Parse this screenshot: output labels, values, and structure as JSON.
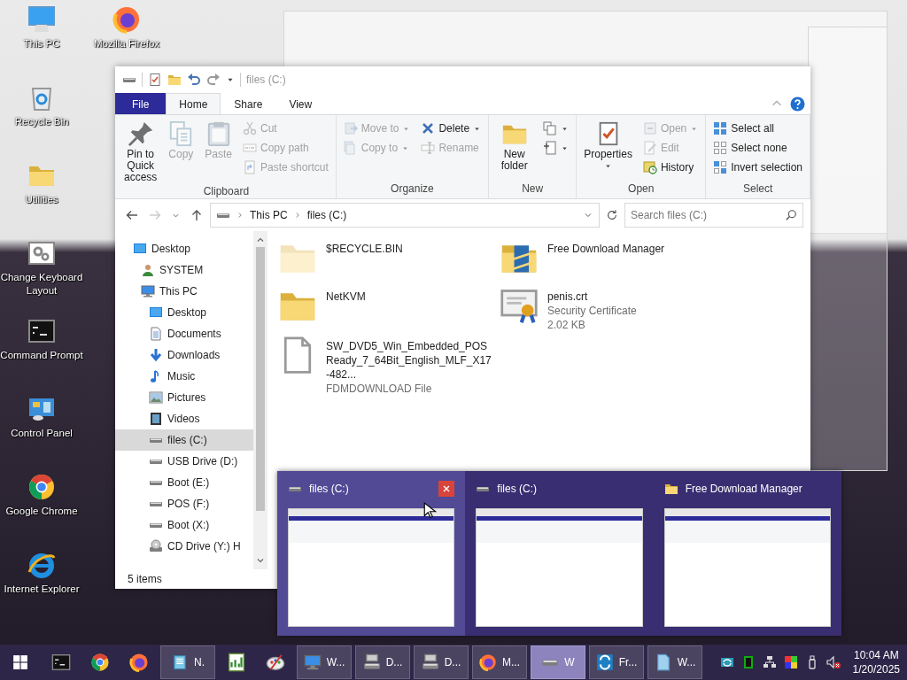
{
  "desktop": {
    "icon_columns": [
      [
        {
          "label": "This PC",
          "kind": "computer"
        },
        {
          "label": "Recycle Bin",
          "kind": "recycle-bin"
        },
        {
          "label": "Utilities",
          "kind": "folder"
        },
        {
          "label": "Change Keyboard Layout",
          "kind": "gear-window"
        },
        {
          "label": "Command Prompt",
          "kind": "cmd"
        },
        {
          "label": "Control Panel",
          "kind": "control-panel"
        },
        {
          "label": "Google Chrome",
          "kind": "chrome"
        },
        {
          "label": "Internet Explorer",
          "kind": "ie"
        }
      ],
      [
        {
          "label": "Mozilla Firefox",
          "kind": "firefox"
        }
      ]
    ]
  },
  "explorer": {
    "title": "files (C:)",
    "tabs": [
      {
        "label": "File",
        "kind": "file-menu",
        "selected": false
      },
      {
        "label": "Home",
        "kind": "tab",
        "selected": true
      },
      {
        "label": "Share",
        "kind": "tab",
        "selected": false
      },
      {
        "label": "View",
        "kind": "tab",
        "selected": false
      }
    ],
    "ribbon": [
      {
        "label": "Clipboard",
        "items": [
          {
            "kind": "pin",
            "label": "Pin to Quick access",
            "disabled": false,
            "dropdown": false
          },
          {
            "kind": "copy",
            "label": "Copy",
            "disabled": true,
            "dropdown": false
          },
          {
            "kind": "paste",
            "label": "Paste",
            "disabled": true,
            "dropdown": false
          },
          {
            "kind": "stack",
            "items": [
              {
                "label": "Cut",
                "kind": "cut",
                "disabled": true,
                "dropdown": false
              },
              {
                "label": "Copy path",
                "kind": "copy-path",
                "disabled": true,
                "dropdown": false
              },
              {
                "label": "Paste shortcut",
                "kind": "paste-shortcut",
                "disabled": true,
                "dropdown": false
              }
            ]
          }
        ]
      },
      {
        "label": "Organize",
        "items": [
          {
            "kind": "stack",
            "items": [
              {
                "label": "Move to",
                "kind": "move-to",
                "disabled": true,
                "dropdown": true
              },
              {
                "label": "Copy to",
                "kind": "copy-to",
                "disabled": true,
                "dropdown": true
              }
            ]
          },
          {
            "kind": "stack",
            "items": [
              {
                "label": "Delete",
                "kind": "delete",
                "disabled": false,
                "dropdown": true
              },
              {
                "label": "Rename",
                "kind": "rename",
                "disabled": true,
                "dropdown": false
              }
            ]
          }
        ]
      },
      {
        "label": "New",
        "items": [
          {
            "kind": "folder",
            "label": "New folder",
            "disabled": false,
            "dropdown": false
          },
          {
            "kind": "stack",
            "items": [
              {
                "kind": "new-item",
                "disabled": false,
                "dropdown": true
              },
              {
                "kind": "easy-access",
                "disabled": false,
                "dropdown": true
              }
            ]
          }
        ]
      },
      {
        "label": "Open",
        "items": [
          {
            "kind": "checkdoc",
            "label": "Properties",
            "disabled": false,
            "dropdown": true
          },
          {
            "kind": "stack",
            "items": [
              {
                "label": "Open",
                "kind": "open",
                "disabled": true,
                "dropdown": true
              },
              {
                "label": "Edit",
                "kind": "edit",
                "disabled": true,
                "dropdown": false
              },
              {
                "label": "History",
                "kind": "history",
                "disabled": false,
                "dropdown": false
              }
            ]
          }
        ]
      },
      {
        "label": "Select",
        "items": [
          {
            "kind": "stack",
            "items": [
              {
                "label": "Select all",
                "kind": "select-all",
                "disabled": false,
                "dropdown": false
              },
              {
                "label": "Select none",
                "kind": "select-none",
                "disabled": false,
                "dropdown": false
              },
              {
                "label": "Invert selection",
                "kind": "invert",
                "disabled": false,
                "dropdown": false
              }
            ]
          }
        ]
      }
    ],
    "address": {
      "crumbs": [
        "This PC",
        "files (C:)"
      ]
    },
    "search": {
      "placeholder": "Search files (C:)"
    },
    "nav_pane": {
      "items": [
        {
          "label": "Desktop",
          "kind": "desktop",
          "selected": false,
          "children": [
            {
              "label": "SYSTEM",
              "kind": "user",
              "selected": false
            },
            {
              "label": "This PC",
              "kind": "monitor",
              "selected": false,
              "children": [
                {
                  "label": "Desktop",
                  "kind": "desktop",
                  "selected": false
                },
                {
                  "label": "Documents",
                  "kind": "documents",
                  "selected": false
                },
                {
                  "label": "Downloads",
                  "kind": "downloads",
                  "selected": false
                },
                {
                  "label": "Music",
                  "kind": "music",
                  "selected": false
                },
                {
                  "label": "Pictures",
                  "kind": "pictures",
                  "selected": false
                },
                {
                  "label": "Videos",
                  "kind": "videos",
                  "selected": false
                },
                {
                  "label": "files (C:)",
                  "kind": "drive",
                  "selected": true
                },
                {
                  "label": "USB Drive (D:)",
                  "kind": "drive",
                  "selected": false
                },
                {
                  "label": "Boot (E:)",
                  "kind": "drive",
                  "selected": false
                },
                {
                  "label": "POS (F:)",
                  "kind": "drive",
                  "selected": false
                },
                {
                  "label": "Boot (X:)",
                  "kind": "drive",
                  "selected": false
                },
                {
                  "label": "CD Drive (Y:) H",
                  "kind": "cd-drive",
                  "selected": false
                }
              ]
            }
          ]
        }
      ]
    },
    "files": [
      {
        "name": "$RECYCLE.BIN",
        "kind": "hidden-folder"
      },
      {
        "name": "Free Download Manager",
        "kind": "app-folder"
      },
      {
        "name": "NetKVM",
        "kind": "folder"
      },
      {
        "name": "penis.crt",
        "kind": "certificate",
        "type": "Security Certificate",
        "size": "2.02 KB"
      },
      {
        "name": "SW_DVD5_Win_Embedded_POSReady_7_64Bit_English_MLF_X17-482...",
        "kind": "file",
        "type": "FDMDOWNLOAD File"
      }
    ],
    "status_bar": "5 items"
  },
  "thumbnail_popup": [
    {
      "title": "files (C:)",
      "kind": "drive",
      "selected": true
    },
    {
      "title": "files (C:)",
      "kind": "drive",
      "selected": false
    },
    {
      "title": "Free Download Manager",
      "kind": "folder",
      "selected": false
    }
  ],
  "taskbar": {
    "buttons": [
      {
        "kind": "windows"
      },
      {
        "kind": "cmd"
      },
      {
        "kind": "chrome"
      },
      {
        "kind": "firefox"
      },
      {
        "kind": "notepad",
        "label": "N.",
        "selected": false
      },
      {
        "kind": "chart"
      },
      {
        "kind": "paint"
      },
      {
        "kind": "monitor",
        "label": "W...",
        "selected": false
      },
      {
        "kind": "device",
        "label": "D...",
        "selected": false
      },
      {
        "kind": "device",
        "label": "D...",
        "selected": false
      },
      {
        "kind": "firefox",
        "label": "M...",
        "selected": false
      },
      {
        "kind": "drive",
        "label": "W",
        "selected": true
      },
      {
        "kind": "fdm",
        "label": "Fr...",
        "selected": false
      },
      {
        "kind": "blue-file",
        "label": "W...",
        "selected": false
      }
    ],
    "clock": {
      "time": "10:04 AM",
      "date": "1/20/2025"
    }
  }
}
